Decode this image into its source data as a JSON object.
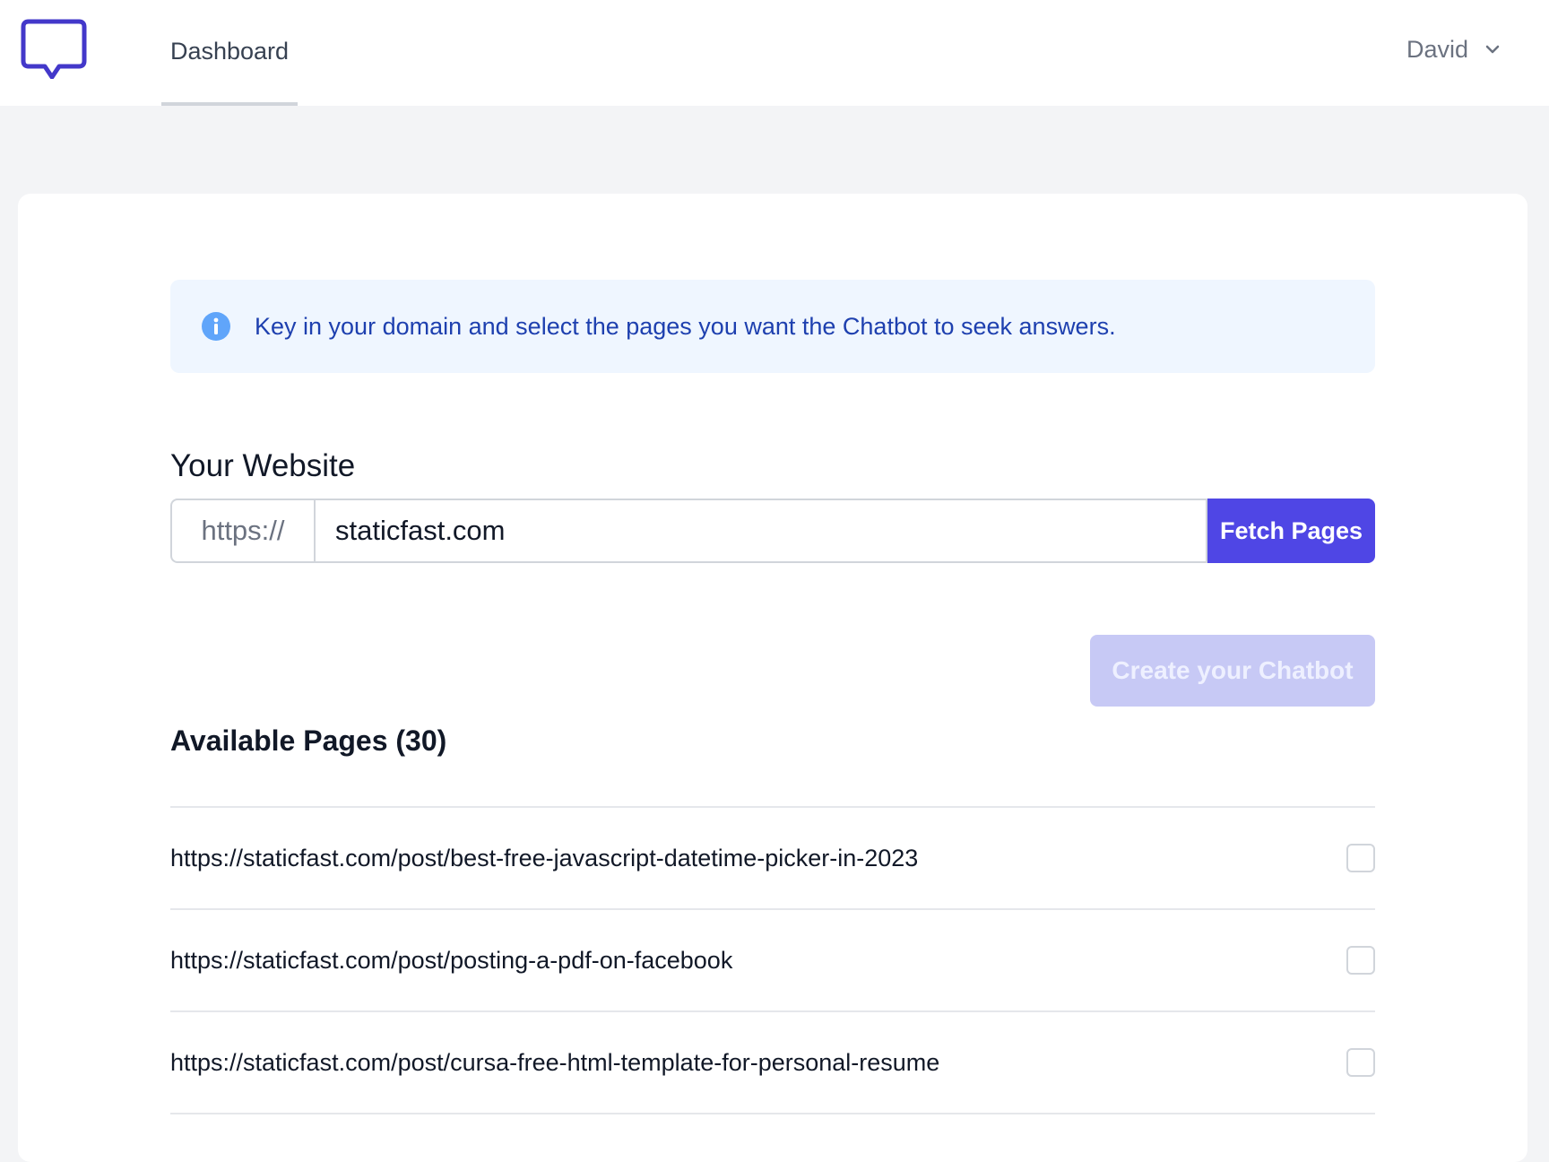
{
  "header": {
    "nav_dashboard": "Dashboard",
    "user_name": "David"
  },
  "alert": {
    "text": "Key in your domain and select the pages you want the Chatbot to seek answers."
  },
  "website": {
    "label": "Your Website",
    "prefix": "https://",
    "value": "staticfast.com",
    "fetch_label": "Fetch Pages"
  },
  "create_label": "Create your Chatbot",
  "pages": {
    "title": "Available Pages (30)",
    "items": [
      {
        "url": "https://staticfast.com/post/best-free-javascript-datetime-picker-in-2023",
        "checked": false
      },
      {
        "url": "https://staticfast.com/post/posting-a-pdf-on-facebook",
        "checked": false
      },
      {
        "url": "https://staticfast.com/post/cursa-free-html-template-for-personal-resume",
        "checked": false
      }
    ]
  },
  "colors": {
    "brand": "#4f46e5",
    "alert_bg": "#eff6ff",
    "alert_text": "#1e40af",
    "disabled_button": "#c7c9f5"
  }
}
